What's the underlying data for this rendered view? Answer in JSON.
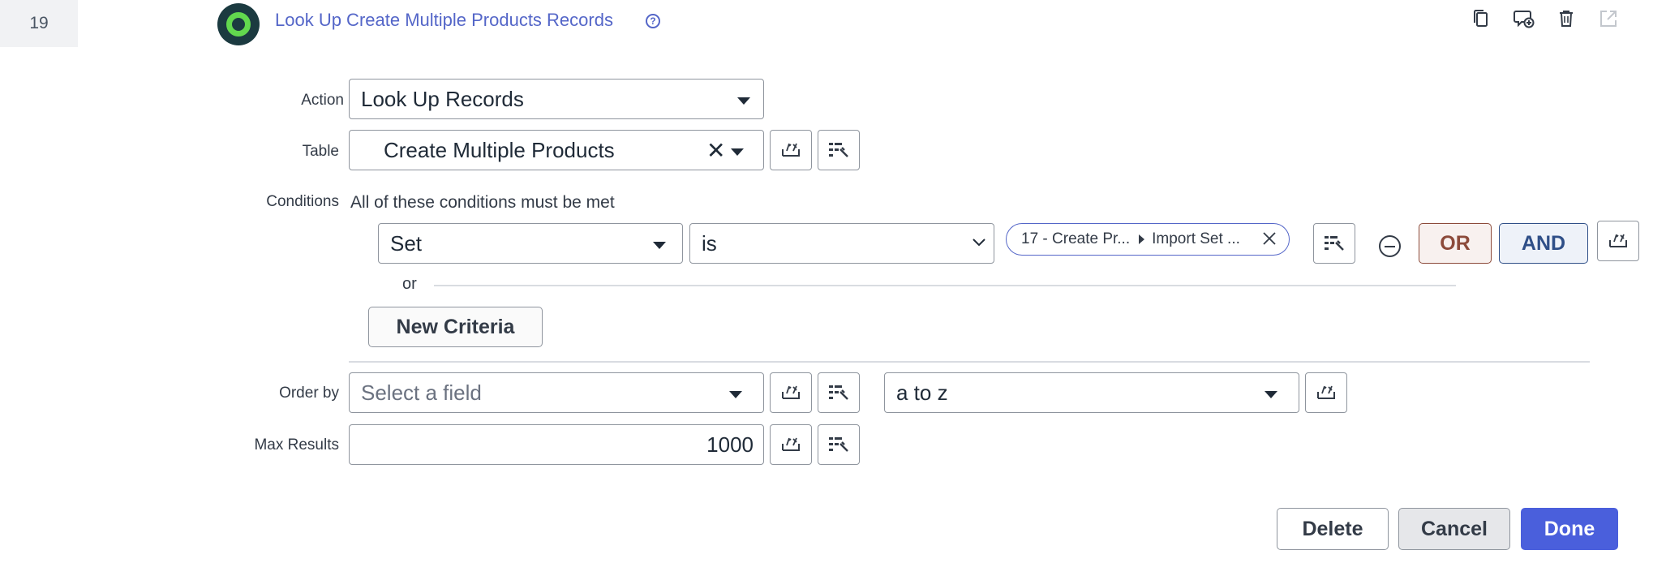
{
  "step": {
    "number": "19",
    "title": "Look Up Create Multiple Products Records",
    "help_icon": "?"
  },
  "header_icons": [
    "copy-icon",
    "comment-add-icon",
    "trash-icon",
    "open-in-new-icon"
  ],
  "action": {
    "label": "Action",
    "value": "Look Up Records"
  },
  "table": {
    "label": "Table",
    "value": "Create Multiple Products",
    "clear_symbol": "✕"
  },
  "conditions": {
    "label": "Conditions",
    "description": "All of these conditions must be met",
    "field": "Set",
    "operator": "is",
    "value_pill": {
      "step": "17 - Create Pr...",
      "field": "Import Set ..."
    },
    "or_button": "OR",
    "and_button": "AND",
    "or_separator": "or",
    "new_criteria": "New Criteria"
  },
  "order_by": {
    "label": "Order by",
    "placeholder": "Select a field",
    "direction": "a to z"
  },
  "max_results": {
    "label": "Max Results",
    "value": "1000"
  },
  "footer": {
    "delete": "Delete",
    "cancel": "Cancel",
    "done": "Done"
  },
  "colors": {
    "accent": "#4a5fdc",
    "title": "#5466c8",
    "or": "#8c4a3a",
    "and": "#2f4f88",
    "logo_ring": "#62d84e"
  }
}
